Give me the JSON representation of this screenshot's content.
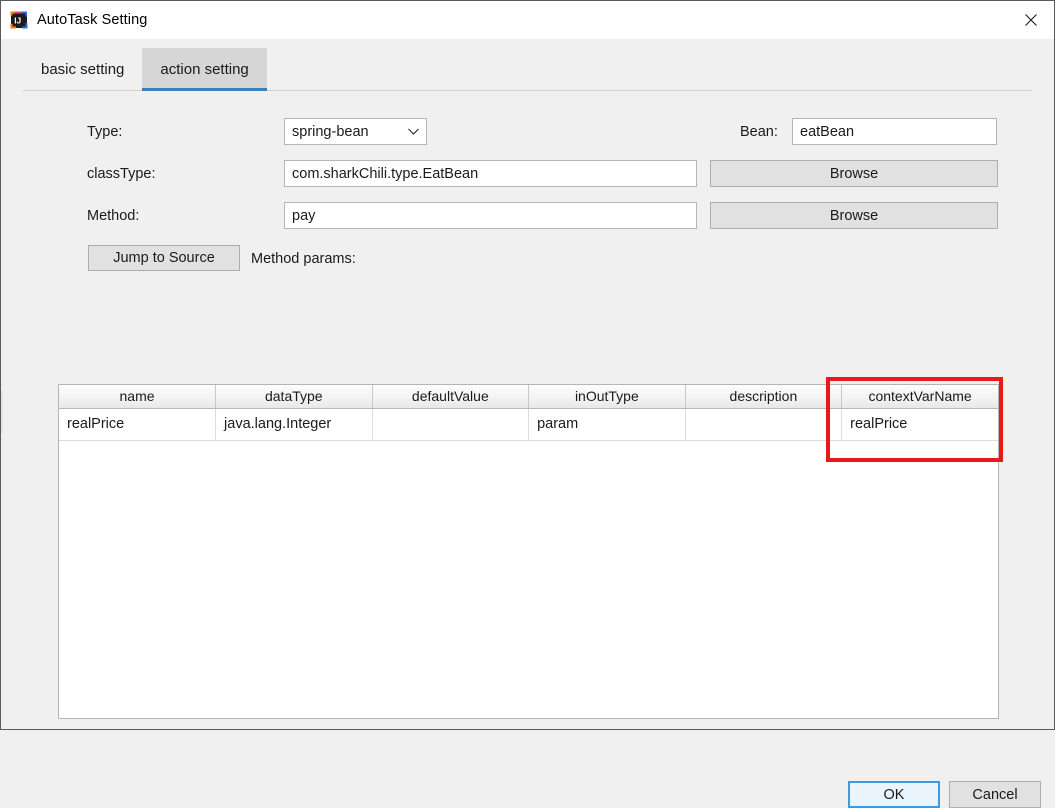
{
  "window": {
    "title": "AutoTask Setting",
    "icon": "intellij-idea-icon",
    "close_label": "✕"
  },
  "tabs": [
    {
      "label": "basic setting",
      "selected": false
    },
    {
      "label": "action setting",
      "selected": true
    }
  ],
  "form": {
    "type_label": "Type:",
    "type_value": "spring-bean",
    "type_chevron": "chevron-down-icon",
    "classtype_label": "classType:",
    "classtype_value": "com.sharkChili.type.EatBean",
    "method_label": "Method:",
    "method_value": "pay",
    "bean_label": "Bean:",
    "bean_value": "eatBean",
    "browse_classtype_label": "Browse",
    "browse_method_label": "Browse",
    "jump_to_source_label": "Jump to Source",
    "method_params_label": "Method params:"
  },
  "table": {
    "columns": [
      "name",
      "dataType",
      "defaultValue",
      "inOutType",
      "description",
      "contextVarName"
    ],
    "rows": [
      {
        "name": "realPrice",
        "dataType": "java.lang.Integer",
        "defaultValue": "",
        "inOutType": "param",
        "description": "",
        "contextVarName": "realPrice"
      }
    ]
  },
  "annotation": {
    "highlight_column": "contextVarName",
    "color": "#e81919"
  },
  "footer": {
    "ok_label": "OK",
    "cancel_label": "Cancel"
  },
  "colors": {
    "dialog_background": "#f0f0f0",
    "tab_selected_background": "#d6d6d6",
    "tab_accent": "#3d7ebd",
    "ok_border": "#3d9ae0",
    "ok_background": "#eaf4fd",
    "annotation_red": "#e81919"
  }
}
